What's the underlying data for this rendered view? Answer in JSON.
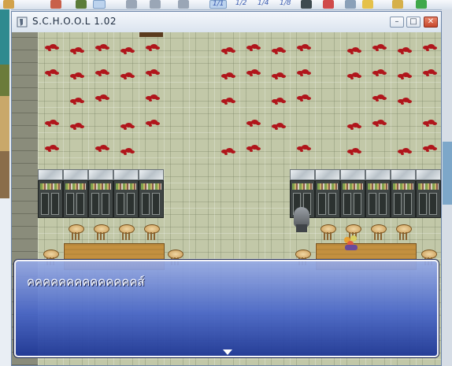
{
  "window": {
    "title": "S.C.H.O.O.L  1.02",
    "minimize_symbol": "–",
    "maximize_symbol": "□",
    "close_symbol": "✕"
  },
  "toolbar": {
    "zoom_options": [
      "1/1",
      "1/2",
      "1/4",
      "1/8"
    ]
  },
  "dialog": {
    "text": "คคคคคคคคคคคคคคส์",
    "continue_indicator": "down-arrow-icon"
  },
  "colors": {
    "dialog_top": "#96aae6",
    "dialog_bottom": "#1e3796",
    "blood": "#b0151b",
    "floor": "#c2c8a8"
  }
}
